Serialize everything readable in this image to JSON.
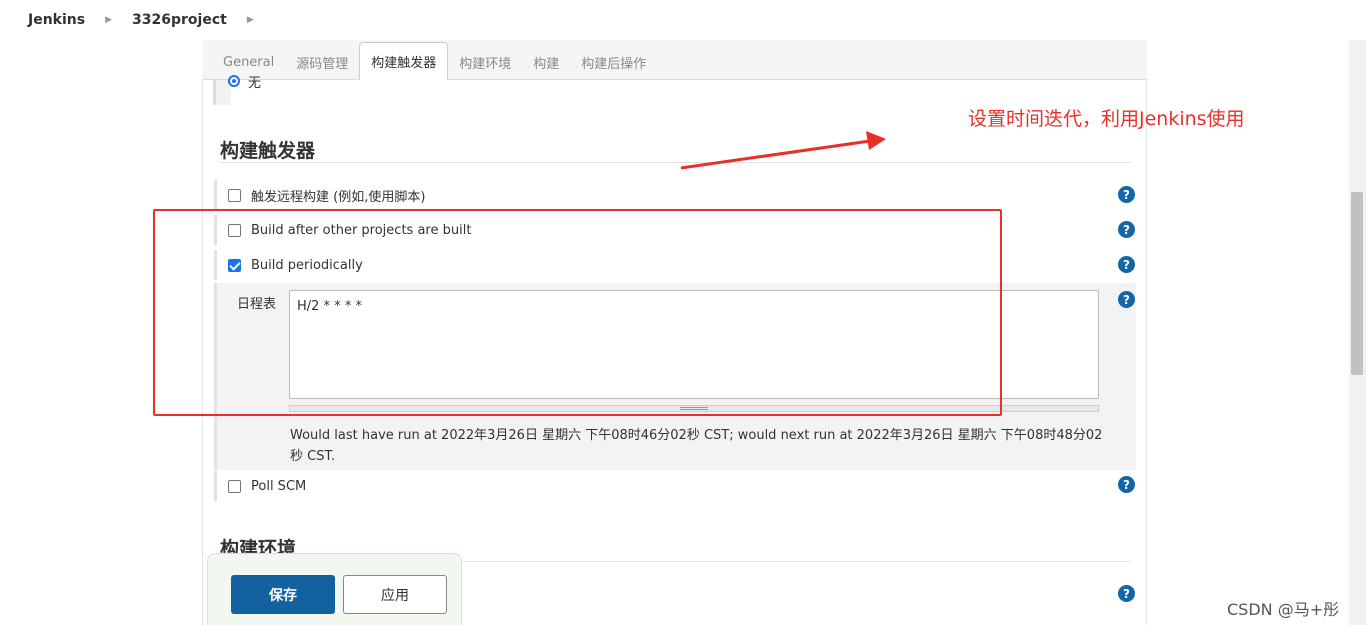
{
  "breadcrumb": [
    {
      "label": "Jenkins"
    },
    {
      "label": "3326project"
    }
  ],
  "tabs": [
    {
      "label": "General"
    },
    {
      "label": "源码管理"
    },
    {
      "label": "构建触发器",
      "active": true
    },
    {
      "label": "构建环境"
    },
    {
      "label": "构建"
    },
    {
      "label": "构建后操作"
    }
  ],
  "radio_none_label": "无",
  "triggers": {
    "title": "构建触发器",
    "remote": {
      "label": "触发远程构建 (例如,使用脚本)",
      "checked": false
    },
    "after_other": {
      "label": "Build after other projects are built",
      "checked": false
    },
    "periodic": {
      "label": "Build periodically",
      "checked": true
    },
    "schedule": {
      "label": "日程表",
      "value": "H/2 * * * *",
      "hint": "Would last have run at 2022年3月26日 星期六 下午08时46分02秒 CST; would next run at 2022年3月26日 星期六 下午08时48分02秒 CST."
    },
    "poll_scm": {
      "label": "Poll SCM",
      "checked": false
    }
  },
  "env_section": {
    "title": "构建环境"
  },
  "buttons": {
    "save": "保存",
    "apply": "应用"
  },
  "annotation": "设置时间迭代，利用Jenkins使用",
  "help_icon": "?",
  "watermark": "CSDN @马+彤",
  "colors": {
    "accent": "#13619e",
    "annotation": "#e8302a",
    "checkbox": "#1a73e8"
  }
}
